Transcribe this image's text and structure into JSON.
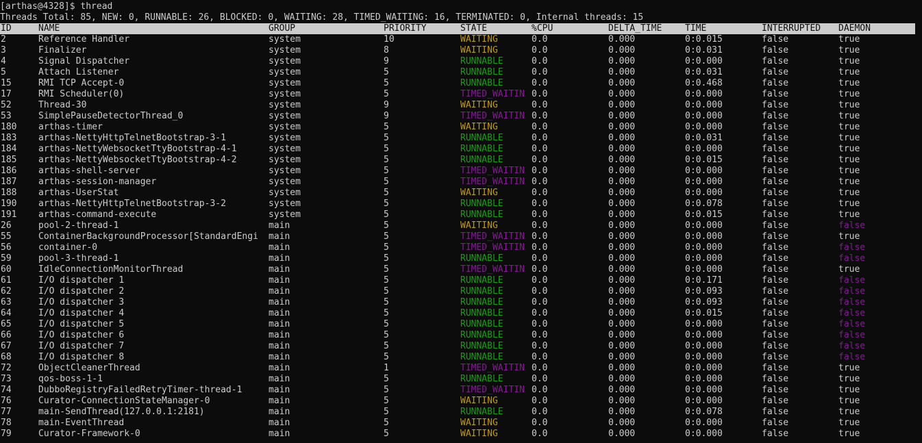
{
  "window": {
    "prompt": "[arthas@4328]$ thread",
    "summary": "Threads Total: 85, NEW: 0, RUNNABLE: 26, BLOCKED: 0, WAITING: 28, TIMED_WAITING: 16, TERMINATED: 0, Internal threads: 15"
  },
  "colors": {
    "background": "#0c0c0c",
    "foreground": "#cccccc",
    "header_bg": "#cccccc",
    "header_fg": "#0c0c0c",
    "waiting": "#c19c00",
    "runnable": "#13a10e",
    "timed_waiting": "#881798",
    "daemon_false": "#881798"
  },
  "table": {
    "columns": [
      "ID",
      "NAME",
      "GROUP",
      "PRIORITY",
      "STATE",
      "%CPU",
      "DELTA_TIME",
      "TIME",
      "INTERRUPTED",
      "DAEMON"
    ],
    "rows": [
      {
        "id": "2",
        "name": "Reference Handler",
        "group": "system",
        "priority": "10",
        "state": "WAITING",
        "cpu": "0.0",
        "delta": "0.000",
        "time": "0:0.015",
        "interrupted": "false",
        "daemon": "true"
      },
      {
        "id": "3",
        "name": "Finalizer",
        "group": "system",
        "priority": "8",
        "state": "WAITING",
        "cpu": "0.0",
        "delta": "0.000",
        "time": "0:0.031",
        "interrupted": "false",
        "daemon": "true"
      },
      {
        "id": "4",
        "name": "Signal Dispatcher",
        "group": "system",
        "priority": "9",
        "state": "RUNNABLE",
        "cpu": "0.0",
        "delta": "0.000",
        "time": "0:0.000",
        "interrupted": "false",
        "daemon": "true"
      },
      {
        "id": "5",
        "name": "Attach Listener",
        "group": "system",
        "priority": "5",
        "state": "RUNNABLE",
        "cpu": "0.0",
        "delta": "0.000",
        "time": "0:0.031",
        "interrupted": "false",
        "daemon": "true"
      },
      {
        "id": "15",
        "name": "RMI TCP Accept-0",
        "group": "system",
        "priority": "5",
        "state": "RUNNABLE",
        "cpu": "0.0",
        "delta": "0.000",
        "time": "0:0.468",
        "interrupted": "false",
        "daemon": "true"
      },
      {
        "id": "17",
        "name": "RMI Scheduler(0)",
        "group": "system",
        "priority": "5",
        "state": "TIMED_WAITIN",
        "cpu": "0.0",
        "delta": "0.000",
        "time": "0:0.000",
        "interrupted": "false",
        "daemon": "true"
      },
      {
        "id": "52",
        "name": "Thread-30",
        "group": "system",
        "priority": "9",
        "state": "WAITING",
        "cpu": "0.0",
        "delta": "0.000",
        "time": "0:0.000",
        "interrupted": "false",
        "daemon": "true"
      },
      {
        "id": "53",
        "name": "SimplePauseDetectorThread_0",
        "group": "system",
        "priority": "9",
        "state": "TIMED_WAITIN",
        "cpu": "0.0",
        "delta": "0.000",
        "time": "0:0.000",
        "interrupted": "false",
        "daemon": "true"
      },
      {
        "id": "180",
        "name": "arthas-timer",
        "group": "system",
        "priority": "5",
        "state": "WAITING",
        "cpu": "0.0",
        "delta": "0.000",
        "time": "0:0.000",
        "interrupted": "false",
        "daemon": "true"
      },
      {
        "id": "183",
        "name": "arthas-NettyHttpTelnetBootstrap-3-1",
        "group": "system",
        "priority": "5",
        "state": "RUNNABLE",
        "cpu": "0.0",
        "delta": "0.000",
        "time": "0:0.031",
        "interrupted": "false",
        "daemon": "true"
      },
      {
        "id": "184",
        "name": "arthas-NettyWebsocketTtyBootstrap-4-1",
        "group": "system",
        "priority": "5",
        "state": "RUNNABLE",
        "cpu": "0.0",
        "delta": "0.000",
        "time": "0:0.000",
        "interrupted": "false",
        "daemon": "true"
      },
      {
        "id": "185",
        "name": "arthas-NettyWebsocketTtyBootstrap-4-2",
        "group": "system",
        "priority": "5",
        "state": "RUNNABLE",
        "cpu": "0.0",
        "delta": "0.000",
        "time": "0:0.015",
        "interrupted": "false",
        "daemon": "true"
      },
      {
        "id": "186",
        "name": "arthas-shell-server",
        "group": "system",
        "priority": "5",
        "state": "TIMED_WAITIN",
        "cpu": "0.0",
        "delta": "0.000",
        "time": "0:0.000",
        "interrupted": "false",
        "daemon": "true"
      },
      {
        "id": "187",
        "name": "arthas-session-manager",
        "group": "system",
        "priority": "5",
        "state": "TIMED_WAITIN",
        "cpu": "0.0",
        "delta": "0.000",
        "time": "0:0.000",
        "interrupted": "false",
        "daemon": "true"
      },
      {
        "id": "188",
        "name": "arthas-UserStat",
        "group": "system",
        "priority": "5",
        "state": "WAITING",
        "cpu": "0.0",
        "delta": "0.000",
        "time": "0:0.000",
        "interrupted": "false",
        "daemon": "true"
      },
      {
        "id": "190",
        "name": "arthas-NettyHttpTelnetBootstrap-3-2",
        "group": "system",
        "priority": "5",
        "state": "RUNNABLE",
        "cpu": "0.0",
        "delta": "0.000",
        "time": "0:0.078",
        "interrupted": "false",
        "daemon": "true"
      },
      {
        "id": "191",
        "name": "arthas-command-execute",
        "group": "system",
        "priority": "5",
        "state": "RUNNABLE",
        "cpu": "0.0",
        "delta": "0.000",
        "time": "0:0.015",
        "interrupted": "false",
        "daemon": "true"
      },
      {
        "id": "26",
        "name": "pool-2-thread-1",
        "group": "main",
        "priority": "5",
        "state": "WAITING",
        "cpu": "0.0",
        "delta": "0.000",
        "time": "0:0.000",
        "interrupted": "false",
        "daemon": "false"
      },
      {
        "id": "55",
        "name": "ContainerBackgroundProcessor[StandardEngi",
        "group": "main",
        "priority": "5",
        "state": "TIMED_WAITIN",
        "cpu": "0.0",
        "delta": "0.000",
        "time": "0:0.000",
        "interrupted": "false",
        "daemon": "true"
      },
      {
        "id": "56",
        "name": "container-0",
        "group": "main",
        "priority": "5",
        "state": "TIMED_WAITIN",
        "cpu": "0.0",
        "delta": "0.000",
        "time": "0:0.000",
        "interrupted": "false",
        "daemon": "false"
      },
      {
        "id": "59",
        "name": "pool-3-thread-1",
        "group": "main",
        "priority": "5",
        "state": "RUNNABLE",
        "cpu": "0.0",
        "delta": "0.000",
        "time": "0:0.000",
        "interrupted": "false",
        "daemon": "false"
      },
      {
        "id": "60",
        "name": "IdleConnectionMonitorThread",
        "group": "main",
        "priority": "5",
        "state": "TIMED_WAITIN",
        "cpu": "0.0",
        "delta": "0.000",
        "time": "0:0.000",
        "interrupted": "false",
        "daemon": "true"
      },
      {
        "id": "61",
        "name": "I/O dispatcher 1",
        "group": "main",
        "priority": "5",
        "state": "RUNNABLE",
        "cpu": "0.0",
        "delta": "0.000",
        "time": "0:0.171",
        "interrupted": "false",
        "daemon": "false"
      },
      {
        "id": "62",
        "name": "I/O dispatcher 2",
        "group": "main",
        "priority": "5",
        "state": "RUNNABLE",
        "cpu": "0.0",
        "delta": "0.000",
        "time": "0:0.093",
        "interrupted": "false",
        "daemon": "false"
      },
      {
        "id": "63",
        "name": "I/O dispatcher 3",
        "group": "main",
        "priority": "5",
        "state": "RUNNABLE",
        "cpu": "0.0",
        "delta": "0.000",
        "time": "0:0.093",
        "interrupted": "false",
        "daemon": "false"
      },
      {
        "id": "64",
        "name": "I/O dispatcher 4",
        "group": "main",
        "priority": "5",
        "state": "RUNNABLE",
        "cpu": "0.0",
        "delta": "0.000",
        "time": "0:0.015",
        "interrupted": "false",
        "daemon": "false"
      },
      {
        "id": "65",
        "name": "I/O dispatcher 5",
        "group": "main",
        "priority": "5",
        "state": "RUNNABLE",
        "cpu": "0.0",
        "delta": "0.000",
        "time": "0:0.000",
        "interrupted": "false",
        "daemon": "false"
      },
      {
        "id": "66",
        "name": "I/O dispatcher 6",
        "group": "main",
        "priority": "5",
        "state": "RUNNABLE",
        "cpu": "0.0",
        "delta": "0.000",
        "time": "0:0.000",
        "interrupted": "false",
        "daemon": "false"
      },
      {
        "id": "67",
        "name": "I/O dispatcher 7",
        "group": "main",
        "priority": "5",
        "state": "RUNNABLE",
        "cpu": "0.0",
        "delta": "0.000",
        "time": "0:0.000",
        "interrupted": "false",
        "daemon": "false"
      },
      {
        "id": "68",
        "name": "I/O dispatcher 8",
        "group": "main",
        "priority": "5",
        "state": "RUNNABLE",
        "cpu": "0.0",
        "delta": "0.000",
        "time": "0:0.000",
        "interrupted": "false",
        "daemon": "false"
      },
      {
        "id": "72",
        "name": "ObjectCleanerThread",
        "group": "main",
        "priority": "1",
        "state": "TIMED_WAITIN",
        "cpu": "0.0",
        "delta": "0.000",
        "time": "0:0.000",
        "interrupted": "false",
        "daemon": "true"
      },
      {
        "id": "73",
        "name": "qos-boss-1-1",
        "group": "main",
        "priority": "5",
        "state": "RUNNABLE",
        "cpu": "0.0",
        "delta": "0.000",
        "time": "0:0.000",
        "interrupted": "false",
        "daemon": "true"
      },
      {
        "id": "74",
        "name": "DubboRegistryFailedRetryTimer-thread-1",
        "group": "main",
        "priority": "5",
        "state": "TIMED_WAITIN",
        "cpu": "0.0",
        "delta": "0.000",
        "time": "0:0.000",
        "interrupted": "false",
        "daemon": "true"
      },
      {
        "id": "76",
        "name": "Curator-ConnectionStateManager-0",
        "group": "main",
        "priority": "5",
        "state": "WAITING",
        "cpu": "0.0",
        "delta": "0.000",
        "time": "0:0.000",
        "interrupted": "false",
        "daemon": "true"
      },
      {
        "id": "77",
        "name": "main-SendThread(127.0.0.1:2181)",
        "group": "main",
        "priority": "5",
        "state": "RUNNABLE",
        "cpu": "0.0",
        "delta": "0.000",
        "time": "0:0.078",
        "interrupted": "false",
        "daemon": "true"
      },
      {
        "id": "78",
        "name": "main-EventThread",
        "group": "main",
        "priority": "5",
        "state": "WAITING",
        "cpu": "0.0",
        "delta": "0.000",
        "time": "0:0.000",
        "interrupted": "false",
        "daemon": "true"
      },
      {
        "id": "79",
        "name": "Curator-Framework-0",
        "group": "main",
        "priority": "5",
        "state": "WAITING",
        "cpu": "0.0",
        "delta": "0.000",
        "time": "0:0.000",
        "interrupted": "false",
        "daemon": "true"
      }
    ]
  }
}
